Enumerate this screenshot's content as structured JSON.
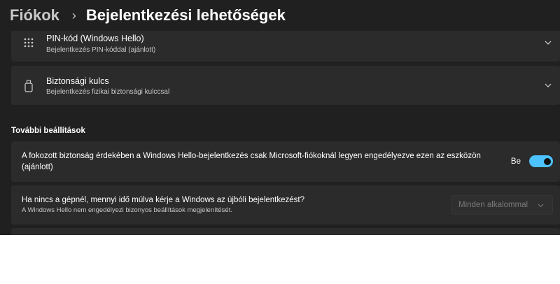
{
  "breadcrumb": {
    "parent": "Fiókok",
    "separator": "›",
    "current": "Bejelentkezési lehetőségek"
  },
  "sign_in_methods": [
    {
      "title": "PIN-kód (Windows Hello)",
      "description": "Bejelentkezés PIN-kóddal (ajánlott)",
      "icon": "keypad-icon"
    },
    {
      "title": "Biztonsági kulcs",
      "description": "Bejelentkezés fizikai biztonsági kulccsal",
      "icon": "usb-key-icon"
    }
  ],
  "additional_settings": {
    "heading": "További beállítások",
    "hello_only": {
      "text_line1": "A fokozott biztonság érdekében a Windows Hello-bejelentkezés csak Microsoft-fiókoknál legyen engedélyezve ezen az eszközön",
      "text_line2": "(ajánlott)",
      "toggle_label": "Be",
      "toggle_on": true
    },
    "require_sign_in": {
      "title": "Ha nincs a gépnél, mennyi idő múlva kérje a Windows az újbóli bejelentkezést?",
      "description": "A Windows Hello nem engedélyezi bizonyos beállítások megjelenítését.",
      "dropdown_value": "Minden alkalommal",
      "disabled": true
    }
  },
  "colors": {
    "background": "#202020",
    "card": "#2b2b2b",
    "accent": "#4cc2ff"
  }
}
